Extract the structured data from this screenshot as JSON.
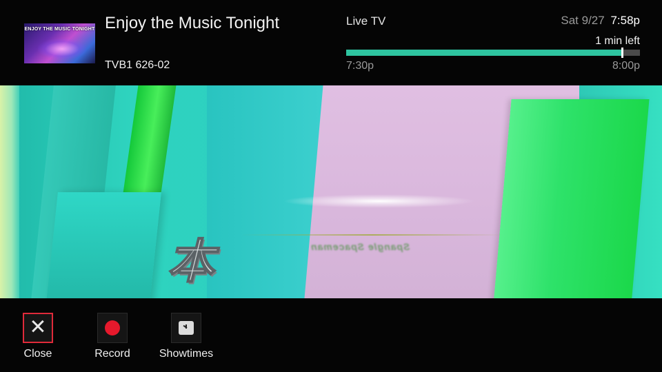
{
  "program": {
    "title": "Enjoy the Music Tonight",
    "channel": "TVB1 626-02",
    "thumbnail_text": "ENJOY THE MUSIC TONIGHT"
  },
  "status": {
    "mode": "Live TV",
    "date": "Sat 9/27",
    "time": "7:58p",
    "time_left": "1 min left"
  },
  "progress": {
    "start": "7:30p",
    "end": "8:00p",
    "percent_elapsed": 94,
    "color": "#2ec4a0"
  },
  "video": {
    "logo_text": "本",
    "overlay_text": "Spangle Spaceman"
  },
  "actions": [
    {
      "label": "Close",
      "icon": "close-icon",
      "focused": true
    },
    {
      "label": "Record",
      "icon": "record-icon",
      "focused": false
    },
    {
      "label": "Showtimes",
      "icon": "clock-icon",
      "focused": false
    }
  ],
  "colors": {
    "focus_border": "#e02a3a",
    "record": "#e6192c"
  }
}
